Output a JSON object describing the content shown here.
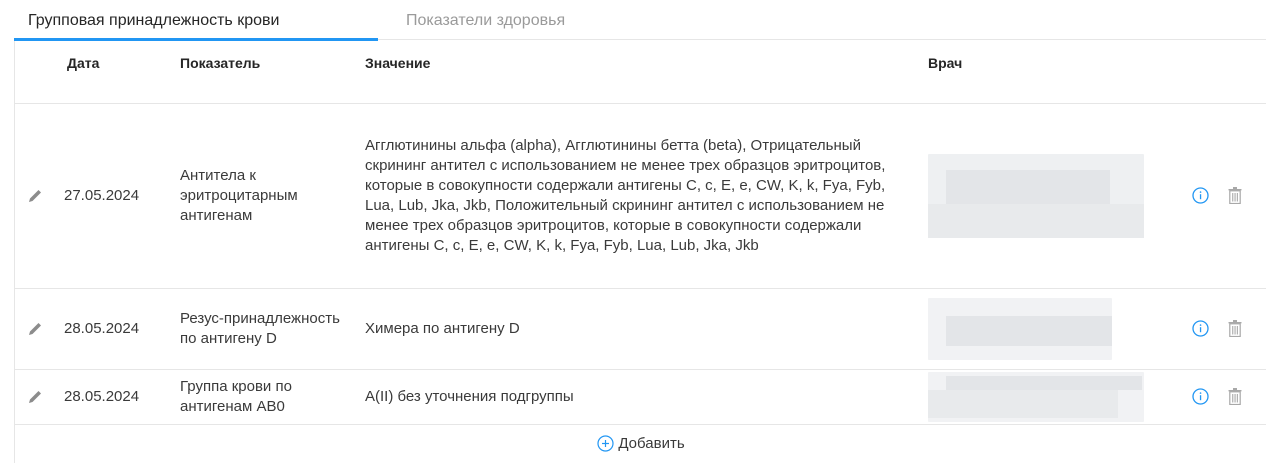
{
  "tabs": [
    {
      "label": "Групповая принадлежность крови",
      "active": true
    },
    {
      "label": "Показатели здоровья",
      "active": false
    }
  ],
  "table": {
    "headers": {
      "date": "Дата",
      "indicator": "Показатель",
      "value": "Значение",
      "doctor": "Врач"
    },
    "rows": [
      {
        "date": "27.05.2024",
        "indicator": "Антитела к эритроцитарным антигенам",
        "value": "Агглютинины альфа (alpha), Агглютинины бетта (beta), Отрицательный скрининг антител с использованием не менее трех образцов эритроцитов, которые в совокупности содержали антигены C, c, E, e, CW, K, k, Fya, Fyb, Lua, Lub, Jka, Jkb, Положительный скрининг антител с использованием не менее трех образцов эритроцитов, которые в совокупности содержали антигены C, c, E, e, CW, K, k, Fya, Fyb, Lua, Lub, Jka, Jkb"
      },
      {
        "date": "28.05.2024",
        "indicator": "Резус-принадлежность по антигену D",
        "value": "Химера по антигену D"
      },
      {
        "date": "28.05.2024",
        "indicator": "Группа крови по антигенам АВ0",
        "value": "А(II) без уточнения подгруппы"
      }
    ]
  },
  "add_label": "Добавить",
  "icons": {
    "edit": "pencil-icon",
    "info": "info-icon",
    "delete": "trash-icon",
    "add": "plus-circle-icon"
  },
  "colors": {
    "accent": "#2196f3",
    "icon_grey": "#8c8c8c",
    "inactive_tab": "#9a9a9a"
  }
}
